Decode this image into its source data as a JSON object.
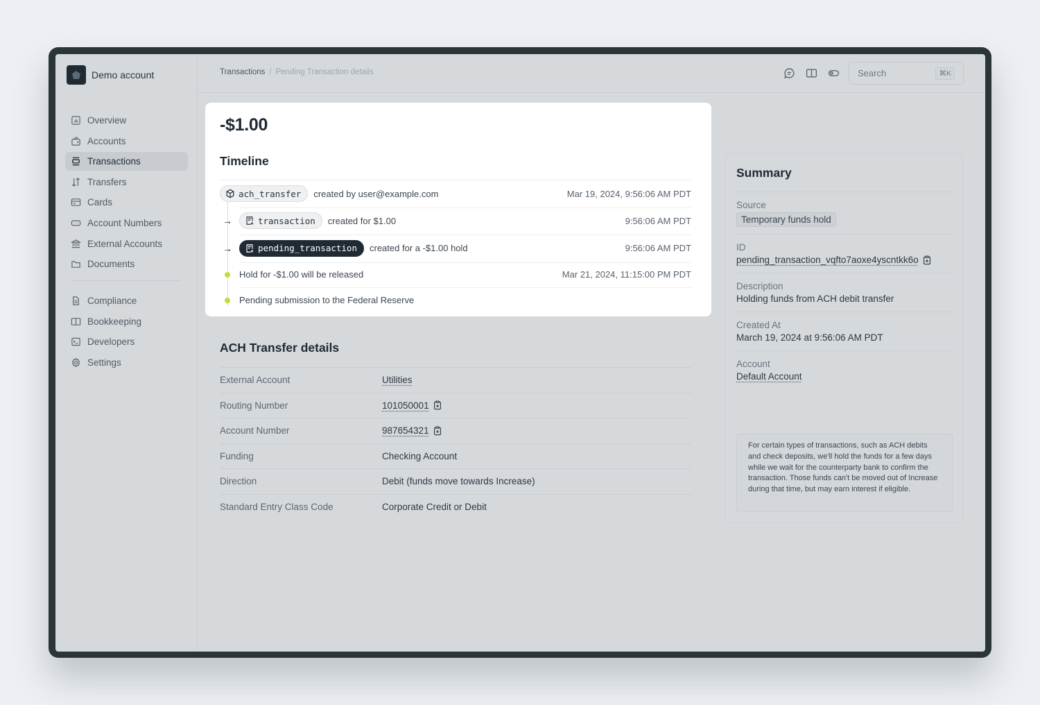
{
  "account": {
    "name": "Demo account"
  },
  "sidebar": {
    "primary": [
      {
        "label": "Overview",
        "icon": "chart-icon",
        "active": false
      },
      {
        "label": "Accounts",
        "icon": "wallet-icon",
        "active": false
      },
      {
        "label": "Transactions",
        "icon": "transactions-icon",
        "active": true
      },
      {
        "label": "Transfers",
        "icon": "arrows-updown-icon",
        "active": false
      },
      {
        "label": "Cards",
        "icon": "card-icon",
        "active": false
      },
      {
        "label": "Account Numbers",
        "icon": "account-numbers-icon",
        "active": false
      },
      {
        "label": "External Accounts",
        "icon": "bank-icon",
        "active": false
      },
      {
        "label": "Documents",
        "icon": "folder-icon",
        "active": false
      }
    ],
    "secondary": [
      {
        "label": "Compliance",
        "icon": "document-icon",
        "active": false
      },
      {
        "label": "Bookkeeping",
        "icon": "book-icon",
        "active": false
      },
      {
        "label": "Developers",
        "icon": "terminal-icon",
        "active": false
      },
      {
        "label": "Settings",
        "icon": "gear-icon",
        "active": false
      }
    ]
  },
  "header": {
    "breadcrumb": {
      "parent": "Transactions",
      "separator": "/",
      "current": "Pending Transaction details"
    },
    "icons": [
      "chat-icon",
      "book-icon",
      "toggle-icon"
    ],
    "search": {
      "placeholder": "Search",
      "shortcut": "⌘K"
    }
  },
  "transaction": {
    "amount": "-$1.00",
    "timeline_title": "Timeline",
    "timeline": [
      {
        "type": "object",
        "pill": "ach_transfer",
        "pill_icon": "cube-icon",
        "text": "created by user@example.com",
        "time": "Mar 19, 2024, 9:56:06 AM PDT"
      },
      {
        "type": "object",
        "pill": "transaction",
        "pill_icon": "receipt-icon",
        "text": "created for $1.00",
        "time": "9:56:06 AM PDT"
      },
      {
        "type": "object",
        "pill": "pending_transaction",
        "pill_icon": "receipt-icon",
        "pill_selected": true,
        "text": "created for a -$1.00 hold",
        "time": "9:56:06 AM PDT"
      },
      {
        "type": "event",
        "text": "Hold for -$1.00 will be released",
        "time": "Mar 21, 2024, 11:15:00 PM PDT"
      },
      {
        "type": "event",
        "text": "Pending submission to the Federal Reserve",
        "time": ""
      }
    ]
  },
  "ach_details": {
    "title": "ACH Transfer details",
    "rows": [
      {
        "label": "External Account",
        "value": "Utilities",
        "link": true,
        "copy": false
      },
      {
        "label": "Routing Number",
        "value": "101050001",
        "link": true,
        "copy": true
      },
      {
        "label": "Account Number",
        "value": "987654321",
        "link": true,
        "copy": true
      },
      {
        "label": "Funding",
        "value": "Checking Account",
        "link": false,
        "copy": false
      },
      {
        "label": "Direction",
        "value": "Debit (funds move towards Increase)",
        "link": false,
        "copy": false
      },
      {
        "label": "Standard Entry Class Code",
        "value": "Corporate Credit or Debit",
        "link": false,
        "copy": false
      }
    ]
  },
  "summary": {
    "title": "Summary",
    "source_label": "Source",
    "source_value": "Temporary funds hold",
    "id_label": "ID",
    "id_value": "pending_transaction_vqfto7aoxe4yscntkk6o",
    "description_label": "Description",
    "description_value": "Holding funds from ACH debit transfer",
    "created_label": "Created At",
    "created_value": "March 19, 2024 at 9:56:06 AM PDT",
    "account_label": "Account",
    "account_value": "Default Account",
    "note": "For certain types of transactions, such as ACH debits and check deposits, we'll hold the funds for a few days while we wait for the counterparty bank to confirm the transaction. Those funds can't be moved out of Increase during that time, but may earn interest if eligible."
  },
  "colors": {
    "accent_dark": "#1f2a33",
    "event_dot": "#c9d93a",
    "frame": "#2b3538"
  }
}
